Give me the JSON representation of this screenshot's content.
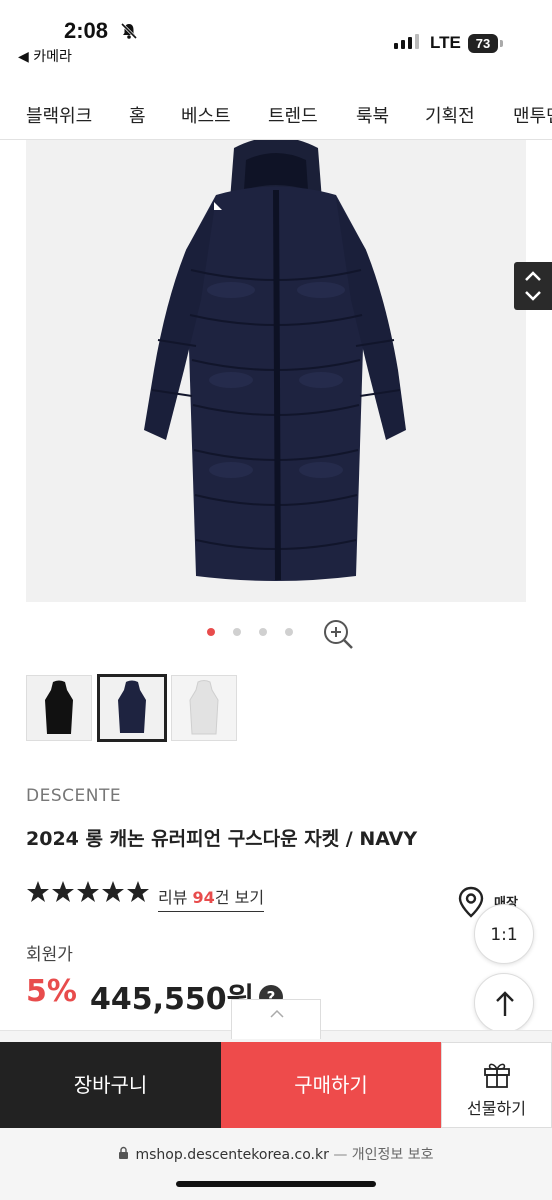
{
  "status_bar": {
    "time": "2:08",
    "back_label": "◀ 카메라",
    "network": "LTE",
    "battery": "73"
  },
  "nav": {
    "items": [
      "블랙위크",
      "홈",
      "베스트",
      "트렌드",
      "룩북",
      "기획전",
      "맨투맨"
    ]
  },
  "gallery": {
    "page_count": 4,
    "active_index": 0,
    "thumbnails": [
      {
        "color": "#111111"
      },
      {
        "color": "#1e2340"
      },
      {
        "color": "#e6e6e6"
      }
    ],
    "selected_thumbnail": 1
  },
  "product": {
    "brand": "DESCENTE",
    "title": "2024 롱 캐논 유러피언 구스다운 자켓 / NAVY",
    "rating_stars": 5,
    "review_prefix": "리뷰 ",
    "review_count": "94",
    "review_suffix": "건 보기",
    "store_label": "매장",
    "member_label": "회원가",
    "discount": "5%",
    "price": "445,550원",
    "help": "?"
  },
  "floating": {
    "chat_label": "1:1"
  },
  "bottom_bar": {
    "cart_label": "장바구니",
    "buy_label": "구매하기",
    "gift_label": "선물하기"
  },
  "url_bar": {
    "url": "mshop.descentekorea.co.kr",
    "separator": " — ",
    "privacy": "개인정보 보호"
  },
  "colors": {
    "accent": "#e84c4c",
    "dark": "#222222",
    "navy": "#1e2340"
  }
}
